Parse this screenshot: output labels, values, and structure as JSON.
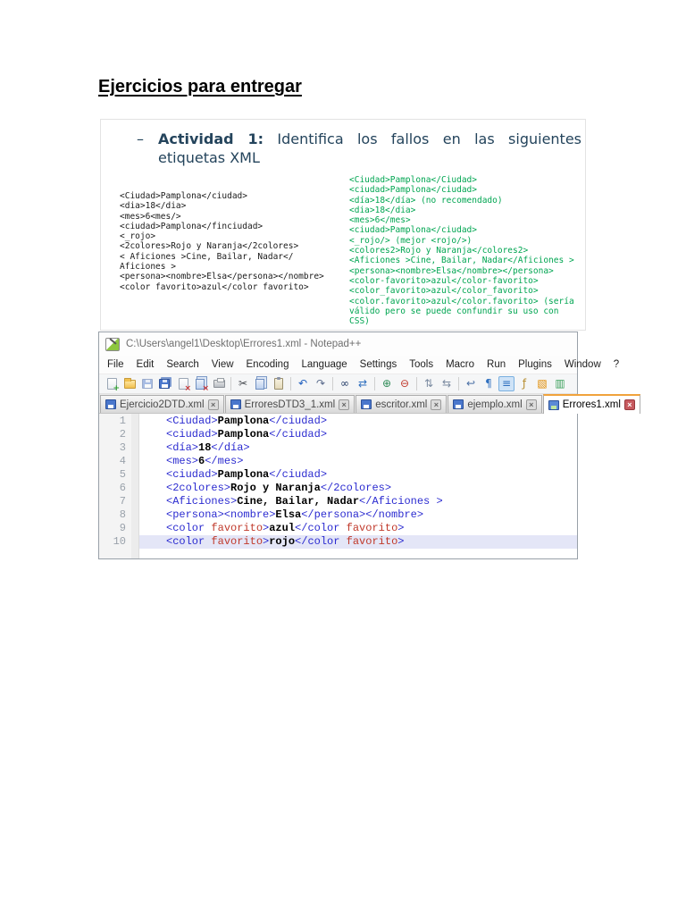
{
  "page": {
    "title": "Ejercicios para entregar"
  },
  "slide": {
    "dash": "–",
    "activity_label": "Actividad 1:",
    "activity_line1_rest": " Identifica los fallos en las siguientes",
    "activity_line2": "etiquetas XML",
    "heading_color": "#24445c",
    "wrong_code_color": "#1a1a1a",
    "corrected_code_color": "#00a551",
    "wrong_code_lines": [
      "<Ciudad>Pamplona</ciudad>",
      "<dia>18</dia>",
      "<mes>6<mes/>",
      "<ciudad>Pamplona</finciudad>",
      "<_rojo>",
      "<2colores>Rojo y Naranja</2colores>",
      "< Aficiones >Cine, Bailar, Nadar</",
      "Aficiones >",
      "<persona><nombre>Elsa</persona></nombre>",
      "<color favorito>azul</color favorito>"
    ],
    "corrected_code_lines": [
      "<Ciudad>Pamplona</Ciudad>",
      "<ciudad>Pamplona</ciudad>",
      "<día>18</día> (no recomendado)",
      "<dia>18</dia>",
      "<mes>6</mes>",
      "<ciudad>Pamplona</ciudad>",
      "<_rojo/> (mejor <rojo/>)",
      "<colores2>Rojo y Naranja</colores2>",
      "<Aficiones >Cine, Bailar, Nadar</Aficiones >",
      "<persona><nombre>Elsa</nombre></persona>",
      "<color-favorito>azul</color-favorito>",
      "<color_favorito>azul</color_favorito>",
      "<color.favorito>azul</color.favorito> (sería",
      "válido pero se puede confundir su uso con",
      "CSS)"
    ]
  },
  "notepad": {
    "window_title": "C:\\Users\\angel1\\Desktop\\Errores1.xml - Notepad++",
    "menu_items": [
      "File",
      "Edit",
      "Search",
      "View",
      "Encoding",
      "Language",
      "Settings",
      "Tools",
      "Macro",
      "Run",
      "Plugins",
      "Window",
      "?"
    ],
    "toolbar": [
      {
        "name": "new-file-icon",
        "shape": "page",
        "badge": "+",
        "badgeColor": "#2ea32e"
      },
      {
        "name": "open-file-icon",
        "shape": "folder"
      },
      {
        "name": "save-icon",
        "shape": "floppy",
        "dim": true
      },
      {
        "name": "save-all-icon",
        "shape": "floppy",
        "stack": true
      },
      {
        "name": "close-file-icon",
        "shape": "page",
        "badge": "×",
        "badgeColor": "#cc3333"
      },
      {
        "name": "close-all-icon",
        "shape": "pages",
        "badge": "×",
        "badgeColor": "#cc3333"
      },
      {
        "name": "print-icon",
        "shape": "printer"
      },
      {
        "divider": true
      },
      {
        "name": "cut-icon",
        "glyph": "✂",
        "color": "#44484e"
      },
      {
        "name": "copy-icon",
        "shape": "pages"
      },
      {
        "name": "paste-icon",
        "shape": "clip"
      },
      {
        "divider": true
      },
      {
        "name": "undo-icon",
        "glyph": "↶",
        "color": "#1f5fbf"
      },
      {
        "name": "redo-icon",
        "glyph": "↷",
        "color": "#5a6b8c"
      },
      {
        "divider": true
      },
      {
        "name": "find-icon",
        "glyph": "∞",
        "color": "#223a66"
      },
      {
        "name": "replace-icon",
        "glyph": "⇄",
        "color": "#2e6fbf"
      },
      {
        "divider": true
      },
      {
        "name": "zoom-in-icon",
        "glyph": "⊕",
        "color": "#2e8b57"
      },
      {
        "name": "zoom-out-icon",
        "glyph": "⊖",
        "color": "#c0392b"
      },
      {
        "divider": true
      },
      {
        "name": "sync-vertical-scroll-icon",
        "glyph": "⇅",
        "color": "#7a8aa0"
      },
      {
        "name": "sync-horizontal-scroll-icon",
        "glyph": "⇆",
        "color": "#7a8aa0"
      },
      {
        "divider": true
      },
      {
        "name": "word-wrap-icon",
        "glyph": "↩",
        "color": "#4a6fa5"
      },
      {
        "name": "show-all-characters-icon",
        "glyph": "¶",
        "color": "#2e6fbf"
      },
      {
        "name": "show-indent-guide-icon",
        "glyph": "≡",
        "color": "#2e6fbf",
        "pressed": true
      },
      {
        "name": "function-list-icon",
        "glyph": "ƒ",
        "color": "#b58a2a"
      },
      {
        "name": "document-map-icon",
        "glyph": "▧",
        "color": "#e08a00"
      },
      {
        "name": "doc-switcher-icon",
        "glyph": "▥",
        "color": "#3aa05a"
      }
    ],
    "tabs": [
      {
        "label": "Ejercicio2DTD.xml",
        "active": false
      },
      {
        "label": "ErroresDTD3_1.xml",
        "active": false
      },
      {
        "label": "escritor.xml",
        "active": false
      },
      {
        "label": "ejemplo.xml",
        "active": false
      },
      {
        "label": "Errores1.xml",
        "active": true
      }
    ],
    "syntax_colors": {
      "tag": "#2b2bd0",
      "text": "#000000",
      "attribute": "#c0392b",
      "current_line_bg": "#e4e6f7"
    },
    "lines": [
      {
        "n": "1",
        "segs": [
          {
            "t": "<Ciudad>",
            "c": "tag"
          },
          {
            "t": "Pamplona",
            "c": "txt"
          },
          {
            "t": "</ciudad>",
            "c": "tag"
          }
        ]
      },
      {
        "n": "2",
        "segs": [
          {
            "t": "<ciudad>",
            "c": "tag"
          },
          {
            "t": "Pamplona",
            "c": "txt"
          },
          {
            "t": "</ciudad>",
            "c": "tag"
          }
        ]
      },
      {
        "n": "3",
        "segs": [
          {
            "t": "<día>",
            "c": "tag"
          },
          {
            "t": "18",
            "c": "txt"
          },
          {
            "t": "</día>",
            "c": "tag"
          }
        ]
      },
      {
        "n": "4",
        "segs": [
          {
            "t": "<mes>",
            "c": "tag"
          },
          {
            "t": "6",
            "c": "txt"
          },
          {
            "t": "</mes>",
            "c": "tag"
          }
        ]
      },
      {
        "n": "5",
        "segs": [
          {
            "t": "<ciudad>",
            "c": "tag"
          },
          {
            "t": "Pamplona",
            "c": "txt"
          },
          {
            "t": "</ciudad>",
            "c": "tag"
          }
        ]
      },
      {
        "n": "6",
        "segs": [
          {
            "t": "<2colores>",
            "c": "tag"
          },
          {
            "t": "Rojo y Naranja",
            "c": "txt"
          },
          {
            "t": "</2colores>",
            "c": "tag"
          }
        ]
      },
      {
        "n": "7",
        "segs": [
          {
            "t": "<Aficiones>",
            "c": "tag"
          },
          {
            "t": "Cine, Bailar, Nadar",
            "c": "txt"
          },
          {
            "t": "</Aficiones >",
            "c": "tag"
          }
        ]
      },
      {
        "n": "8",
        "segs": [
          {
            "t": "<persona><nombre>",
            "c": "tag"
          },
          {
            "t": "Elsa",
            "c": "txt"
          },
          {
            "t": "</persona></nombre>",
            "c": "tag"
          }
        ]
      },
      {
        "n": "9",
        "segs": [
          {
            "t": "<color ",
            "c": "tag"
          },
          {
            "t": "favorito",
            "c": "attr"
          },
          {
            "t": ">",
            "c": "tag"
          },
          {
            "t": "azul",
            "c": "txt"
          },
          {
            "t": "</color ",
            "c": "tag"
          },
          {
            "t": "favorito",
            "c": "attr"
          },
          {
            "t": ">",
            "c": "tag"
          }
        ]
      },
      {
        "n": "10",
        "current": true,
        "segs": [
          {
            "t": "<color ",
            "c": "tag"
          },
          {
            "t": "favorito",
            "c": "attr"
          },
          {
            "t": ">",
            "c": "tag"
          },
          {
            "t": "rojo",
            "c": "txt"
          },
          {
            "t": "</color ",
            "c": "tag"
          },
          {
            "t": "favorito",
            "c": "attr"
          },
          {
            "t": ">",
            "c": "tag"
          }
        ]
      }
    ]
  }
}
